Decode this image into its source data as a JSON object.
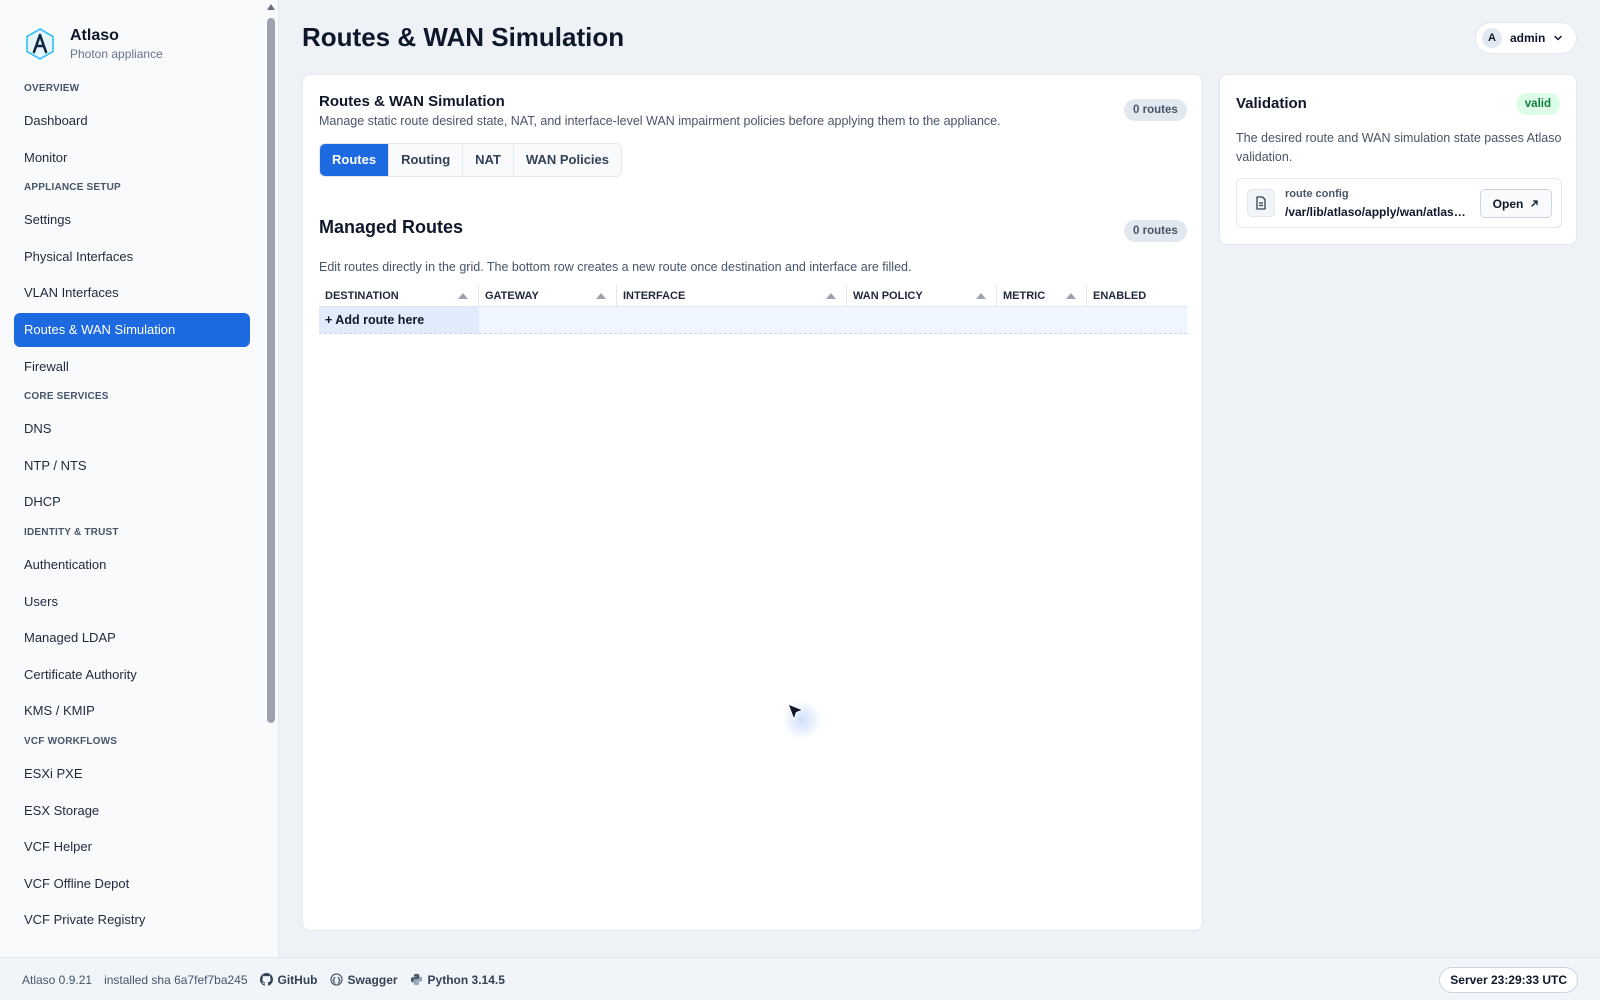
{
  "brand": {
    "name": "Atlaso",
    "subtitle": "Photon appliance",
    "logo_icon": "atlaso-logo-icon"
  },
  "nav": {
    "sections": [
      {
        "title": "OVERVIEW",
        "items": [
          "Dashboard",
          "Monitor"
        ]
      },
      {
        "title": "APPLIANCE SETUP",
        "items": [
          "Settings",
          "Physical Interfaces",
          "VLAN Interfaces",
          "Routes & WAN Simulation",
          "Firewall"
        ]
      },
      {
        "title": "CORE SERVICES",
        "items": [
          "DNS",
          "NTP / NTS",
          "DHCP"
        ]
      },
      {
        "title": "IDENTITY & TRUST",
        "items": [
          "Authentication",
          "Users",
          "Managed LDAP",
          "Certificate Authority",
          "KMS / KMIP"
        ]
      },
      {
        "title": "VCF WORKFLOWS",
        "items": [
          "ESXi PXE",
          "ESX Storage",
          "VCF Helper",
          "VCF Offline Depot",
          "VCF Private Registry"
        ]
      }
    ],
    "active": "Routes & WAN Simulation"
  },
  "header": {
    "title": "Routes & WAN Simulation"
  },
  "user": {
    "avatar_letter": "A",
    "name": "admin"
  },
  "main": {
    "title": "Routes & WAN Simulation",
    "description": "Manage static route desired state, NAT, and interface-level WAN impairment policies before applying them to the appliance.",
    "count_badge": "0 routes",
    "tabs": [
      "Routes",
      "Routing",
      "NAT",
      "WAN Policies"
    ],
    "active_tab": "Routes",
    "section": {
      "title": "Managed Routes",
      "count_badge": "0 routes",
      "description": "Edit routes directly in the grid. The bottom row creates a new route once destination and interface are filled."
    },
    "grid": {
      "columns": [
        "DESTINATION",
        "GATEWAY",
        "INTERFACE",
        "WAN POLICY",
        "METRIC",
        "ENABLED"
      ],
      "add_row_label": "+ Add route here"
    }
  },
  "validation": {
    "title": "Validation",
    "status": "valid",
    "status_color": "#15803d",
    "description": "The desired route and WAN simulation state passes Atlaso validation.",
    "config": {
      "label": "route config",
      "path": "/var/lib/atlaso/apply/wan/atlaso-routes.json",
      "open_label": "Open"
    }
  },
  "footer": {
    "version": "Atlaso 0.9.21",
    "installed_sha": "installed sha 6a7fef7ba245",
    "links": [
      "GitHub",
      "Swagger",
      "Python 3.14.5"
    ],
    "server_time": "Server 23:29:33 UTC"
  },
  "colors": {
    "accent": "#1d6ae0",
    "valid_bg": "#dcfce7"
  }
}
